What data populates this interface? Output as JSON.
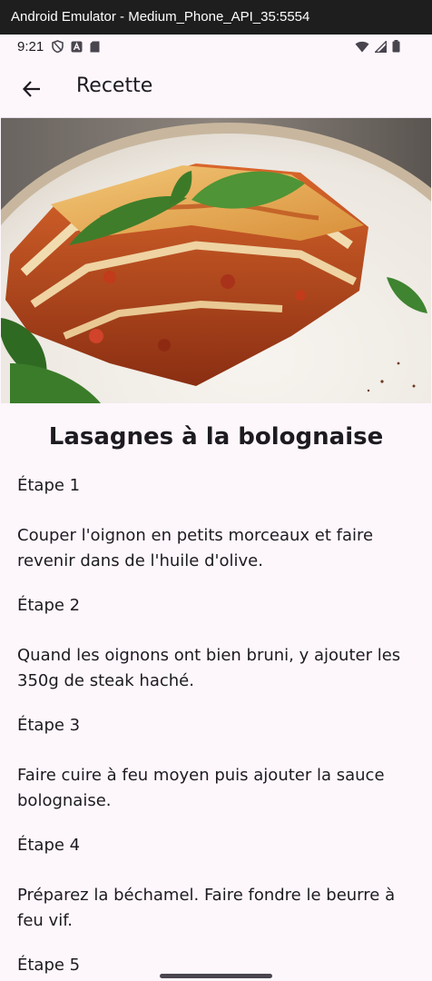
{
  "window": {
    "title": "Android Emulator - Medium_Phone_API_35:5554"
  },
  "status_bar": {
    "time": "9:21",
    "left_icons": [
      "shield-icon",
      "a-icon",
      "sd-card-icon"
    ],
    "right_icons": [
      "wifi-icon",
      "signal-icon",
      "battery-icon"
    ]
  },
  "app_bar": {
    "title": "Recette",
    "back_icon": "arrow-back-icon"
  },
  "recipe": {
    "image_alt": "lasagne-photo",
    "title": "Lasagnes à la bolognaise",
    "steps": [
      {
        "title": "Étape 1",
        "text": "Couper l'oignon en petits morceaux et faire revenir dans de l'huile d'olive."
      },
      {
        "title": "Étape 2",
        "text": "Quand les oignons ont bien bruni, y ajouter les 350g de steak haché."
      },
      {
        "title": "Étape 3",
        "text": "Faire cuire à feu moyen puis ajouter la sauce bolognaise."
      },
      {
        "title": "Étape 4",
        "text": "Préparez la béchamel. Faire fondre le beurre à feu vif."
      },
      {
        "title": "Étape 5",
        "text": ""
      }
    ]
  },
  "colors": {
    "background": "#fdf7fc",
    "text": "#1d1b20",
    "sauce": "#b5431c"
  }
}
